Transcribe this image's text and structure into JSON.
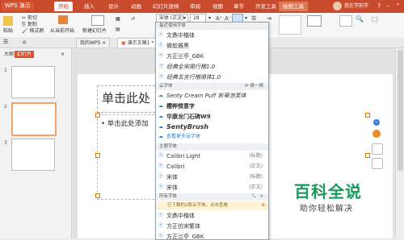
{
  "titlebar": {
    "logo": "WPS 演示",
    "tabs": [
      "开始",
      "插入",
      "设计",
      "动画",
      "幻灯片放映",
      "审阅",
      "视图",
      "章节",
      "开发工具",
      "绘图工具"
    ],
    "active_tab": "开始",
    "user": "我在学前学"
  },
  "ribbon": {
    "paste_label": "粘贴",
    "cut_label": "剪切",
    "copy_label": "复制",
    "format_painter_label": "格式刷",
    "from_current_label": "从当前开始",
    "new_slide_label": "新建幻灯片",
    "font_name": "宋体 (正文)",
    "font_size": "28",
    "bold": "B",
    "italic": "I",
    "underline": "U"
  },
  "doc_tabs": [
    {
      "label": "我的WPS",
      "active": false
    },
    {
      "label": "演示文稿1 *",
      "active": true
    }
  ],
  "left_panel": {
    "tabs": [
      "大纲",
      "幻灯片"
    ],
    "thumbs": [
      "1",
      "2",
      "3"
    ]
  },
  "slide": {
    "title_placeholder": "单击此处",
    "body_placeholder": "• 单击此处添加"
  },
  "font_dropdown": {
    "recent_header": "最近使用字体",
    "recent": [
      "文鼎中楷体",
      "微软雅黑",
      "方正兰亭_GBK",
      "经典全宋简行楷1.0",
      "经典五言行楷简体1.0"
    ],
    "cloud_header": "云字体",
    "cloud_action": "换一换",
    "cloud": [
      "Senty Cream Puff 新蒂泡芙体",
      "樱桦情意字",
      "华康龙门石碑W9",
      "SentyBrush"
    ],
    "cloud_more": "查看更多云字体",
    "theme_header": "主题字体",
    "theme": [
      {
        "name": "Calibri Light",
        "tag": "(标题)"
      },
      {
        "name": "Calibri",
        "tag": "(正文)"
      },
      {
        "name": "宋体",
        "tag": "(标题)"
      },
      {
        "name": "宋体",
        "tag": "(正文)"
      }
    ],
    "all_header": "所有字体",
    "notice": "已下载的2款云字体，点击查看",
    "all": [
      "文鼎中楷体",
      "方正仿宋繁体",
      "方正兰亭_GBK"
    ]
  },
  "watermark": {
    "main": "百科全说",
    "sub": "助你轻松解决"
  },
  "colors": {
    "accent": "#c94b2d",
    "brand_green": "#1a9a5a",
    "selection_orange": "#f4a46b"
  }
}
